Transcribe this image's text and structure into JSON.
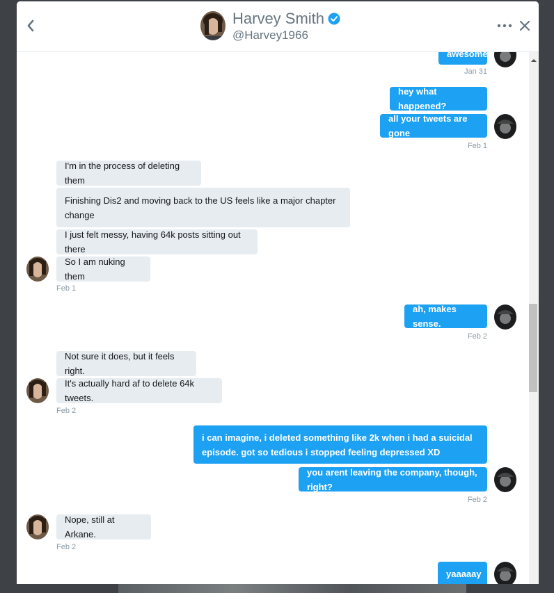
{
  "header": {
    "name": "Harvey Smith",
    "handle": "@Harvey1966"
  },
  "colors": {
    "sent_bubble": "#1da1f2",
    "received_bubble": "#e6ecf0",
    "timestamp": "#8899a6",
    "verified": "#1da1f2"
  },
  "messages": [
    {
      "dir": "sent",
      "text": "awesome"
    },
    {
      "dir": "sent",
      "stamp": "Jan 31"
    },
    {
      "dir": "sent",
      "text": "hey what happened?"
    },
    {
      "dir": "sent",
      "text": "all your tweets are gone"
    },
    {
      "dir": "sent",
      "stamp": "Feb 1"
    },
    {
      "dir": "received",
      "text": "I'm in the process of deleting them"
    },
    {
      "dir": "received",
      "text": "Finishing Dis2 and moving back to the US feels like a major chapter change"
    },
    {
      "dir": "received",
      "text": "I just felt messy, having 64k posts sitting out there"
    },
    {
      "dir": "received",
      "text": "So I am nuking them"
    },
    {
      "dir": "received",
      "stamp": "Feb 1"
    },
    {
      "dir": "sent",
      "text": "ah, makes sense."
    },
    {
      "dir": "sent",
      "stamp": "Feb 2"
    },
    {
      "dir": "received",
      "text": "Not sure it does, but it feels right."
    },
    {
      "dir": "received",
      "text": "It's actually hard af to delete 64k tweets."
    },
    {
      "dir": "received",
      "stamp": "Feb 2"
    },
    {
      "dir": "sent",
      "text": "i can imagine, i deleted something like 2k when i had a suicidal episode. got so tedious i stopped feeling depressed XD"
    },
    {
      "dir": "sent",
      "text": "you arent leaving the company, though, right?"
    },
    {
      "dir": "sent",
      "stamp": "Feb 2"
    },
    {
      "dir": "received",
      "text": "Nope, still at Arkane."
    },
    {
      "dir": "received",
      "stamp": "Feb 2"
    },
    {
      "dir": "sent",
      "text": "yaaaaay"
    }
  ]
}
